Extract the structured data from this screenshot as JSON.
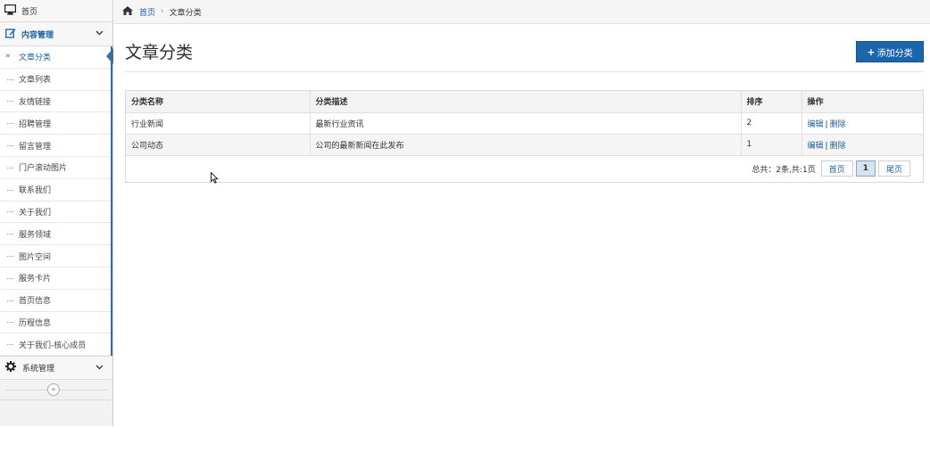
{
  "sidebar": {
    "home": {
      "label": "首页",
      "icon": "monitor-icon"
    },
    "content_group": {
      "label": "内容管理",
      "icon": "edit-icon"
    },
    "items": [
      {
        "label": "文章分类",
        "active": true
      },
      {
        "label": "文章列表"
      },
      {
        "label": "友情链接"
      },
      {
        "label": "招聘管理"
      },
      {
        "label": "留言管理"
      },
      {
        "label": "门户滚动图片"
      },
      {
        "label": "联系我们"
      },
      {
        "label": "关于我们"
      },
      {
        "label": "服务领域"
      },
      {
        "label": "图片空间"
      },
      {
        "label": "服务卡片"
      },
      {
        "label": "首页信息"
      },
      {
        "label": "历程信息"
      },
      {
        "label": "关于我们-核心成员"
      }
    ],
    "system_group": {
      "label": "系统管理",
      "icon": "gear-icon"
    },
    "active_marker": "»",
    "collapse_icon": "«"
  },
  "breadcrumb": {
    "home": "首页",
    "separator": "›",
    "current": "文章分类"
  },
  "page": {
    "title": "文章分类",
    "add_button": "添加分类",
    "add_icon": "+"
  },
  "table": {
    "headers": [
      "分类名称",
      "分类描述",
      "排序",
      "操作"
    ],
    "rows": [
      {
        "name": "行业新闻",
        "desc": "最新行业资讯",
        "order": "2"
      },
      {
        "name": "公司动态",
        "desc": "公司的最新新闻在此发布",
        "order": "1"
      }
    ],
    "op_edit": "编辑",
    "op_sep": "|",
    "op_delete": "删除"
  },
  "pagination": {
    "info": "总共：2条,共:1页",
    "first": "首页",
    "current": "1",
    "last": "尾页"
  },
  "colors": {
    "accent": "#1b65aa",
    "link": "#1d5f9b"
  }
}
